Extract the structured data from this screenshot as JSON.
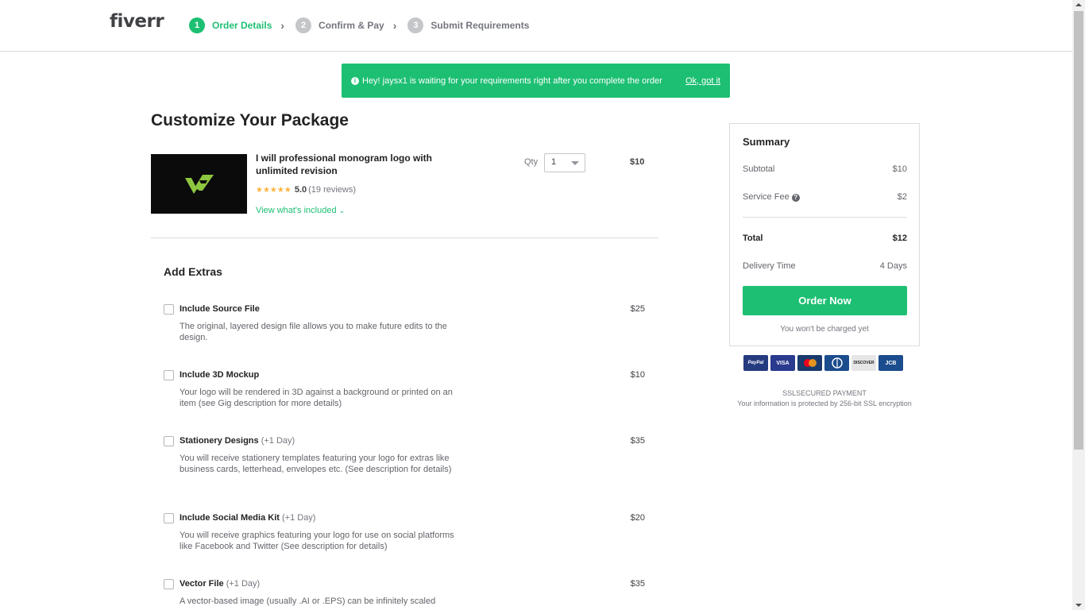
{
  "header": {
    "logo": "fiverr",
    "steps": [
      {
        "num": "1",
        "label": "Order Details",
        "active": true
      },
      {
        "num": "2",
        "label": "Confirm & Pay",
        "active": false
      },
      {
        "num": "3",
        "label": "Submit Requirements",
        "active": false
      }
    ]
  },
  "notice": {
    "icon": "info-icon",
    "text": "Hey! jaysx1 is waiting for your requirements right after you complete the order",
    "link": "Ok, got it"
  },
  "main": {
    "title": "Customize Your Package",
    "gig": {
      "title": "I will professional monogram logo with unlimited revision",
      "stars": "★★★★★",
      "rating": "5.0",
      "reviews": "(19 reviews)",
      "view_link": "View what's included",
      "qty_label": "Qty",
      "qty_value": "1",
      "price": "$10"
    },
    "extras_title": "Add Extras",
    "extras": [
      {
        "title": "Include Source File",
        "days": "",
        "desc": "The original, layered design file allows you to make future edits to the design.",
        "price": "$25"
      },
      {
        "title": "Include 3D Mockup",
        "days": "",
        "desc": "Your logo will be rendered in 3D against a background or printed on an item (see Gig description for more details)",
        "price": "$10"
      },
      {
        "title": "Stationery Designs",
        "days": "(+1 Day)",
        "desc": "You will receive stationery templates featuring your logo for extras like business cards, letterhead, envelopes etc. (See description for details)",
        "price": "$35"
      },
      {
        "title": "Include Social Media Kit",
        "days": "(+1 Day)",
        "desc": "You will receive graphics featuring your logo for use on social platforms like Facebook and Twitter (See description for details)",
        "price": "$20"
      },
      {
        "title": "Vector File",
        "days": "(+1 Day)",
        "desc": "A vector-based image (usually .AI or .EPS) can be infinitely scaled",
        "price": "$35"
      }
    ]
  },
  "summary": {
    "title": "Summary",
    "subtotal_label": "Subtotal",
    "subtotal": "$10",
    "fee_label": "Service Fee",
    "fee": "$2",
    "total_label": "Total",
    "total": "$12",
    "delivery_label": "Delivery Time",
    "delivery": "4 Days",
    "order_button": "Order Now",
    "not_charged": "You won't be charged yet"
  },
  "payments": [
    {
      "name": "PayPal",
      "color": "#253b80"
    },
    {
      "name": "VISA",
      "color": "#2a3a8e"
    },
    {
      "name": "MC",
      "color": "#1a3a6e"
    },
    {
      "name": "DC",
      "color": "#1b4c8d"
    },
    {
      "name": "DISCOVER",
      "color": "#e6e6e6"
    },
    {
      "name": "JCB",
      "color": "#1b4c8d"
    }
  ],
  "ssl": {
    "title": "SSLSECURED PAYMENT",
    "desc": "Your information is protected by 256-bit SSL encryption"
  },
  "colors": {
    "brand_green": "#1dbf73",
    "text_dark": "#222325"
  }
}
